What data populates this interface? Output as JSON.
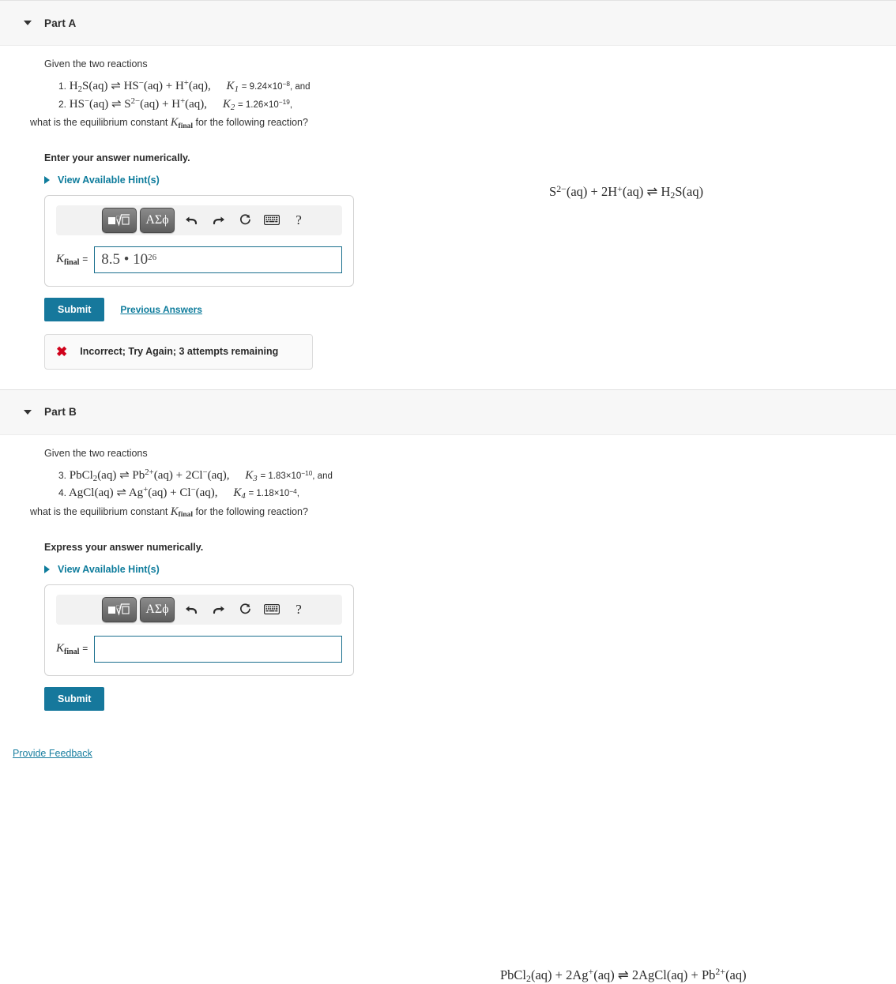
{
  "parts": [
    {
      "id": "part-a",
      "title": "Part A",
      "lead": "Given the two reactions",
      "reactions": [
        {
          "num": "1.",
          "equation": "H2S(aq) ⇌ HS−(aq) + H+(aq),",
          "k_symbol": "K1",
          "k_value": "= 9.24×10−8",
          "tail": ", and"
        },
        {
          "num": "2.",
          "equation": "HS−(aq) ⇌ S2−(aq) + H+(aq),",
          "k_symbol": "K2",
          "k_value": "= 1.26×10−19",
          "tail": ","
        }
      ],
      "question": "what is the equilibrium constant Kfinal for the following reaction?",
      "target_reaction": "S2−(aq) + 2H+(aq) ⇌ H2S(aq)",
      "prompt": "Enter your answer numerically.",
      "hints_label": "View Available Hint(s)",
      "input_label": "Kfinal =",
      "answer_value": "8.5 • 10",
      "answer_exponent": "26",
      "answer_placeholder": "",
      "submit_label": "Submit",
      "previous_answers_label": "Previous Answers",
      "feedback": "Incorrect; Try Again; 3 attempts remaining",
      "feedback_icon": "x-mark"
    },
    {
      "id": "part-b",
      "title": "Part B",
      "lead": "Given the two reactions",
      "reactions": [
        {
          "num": "3.",
          "equation": "PbCl2(aq) ⇌ Pb2+(aq) + 2Cl−(aq),",
          "k_symbol": "K3",
          "k_value": "= 1.83×10−10",
          "tail": ", and"
        },
        {
          "num": "4.",
          "equation": "AgCl(aq) ⇌ Ag+(aq) + Cl−(aq),",
          "k_symbol": "K4",
          "k_value": "= 1.18×10−4",
          "tail": ","
        }
      ],
      "question": "what is the equilibrium constant Kfinal for the following reaction?",
      "target_reaction": "PbCl2(aq) + 2Ag+(aq) ⇌ 2AgCl(aq) + Pb2+(aq)",
      "prompt": "Express your answer numerically.",
      "hints_label": "View Available Hint(s)",
      "input_label": "Kfinal =",
      "answer_value": "",
      "answer_exponent": "",
      "answer_placeholder": "",
      "submit_label": "Submit",
      "previous_answers_label": "",
      "feedback": "",
      "feedback_icon": ""
    }
  ],
  "toolbar": {
    "template_button": "template-tool",
    "greek_button": "ΑΣϕ",
    "undo": "undo-arrow",
    "redo": "redo-arrow",
    "reset": "reset-circle",
    "keyboard": "keyboard",
    "help": "?"
  },
  "footer": {
    "feedback_link": "Provide Feedback"
  },
  "colors": {
    "accent": "#16789c",
    "link": "#0e7c9c",
    "error": "#d0021b",
    "header_bg": "#f7f7f7",
    "input_border": "#1a6f8e"
  }
}
